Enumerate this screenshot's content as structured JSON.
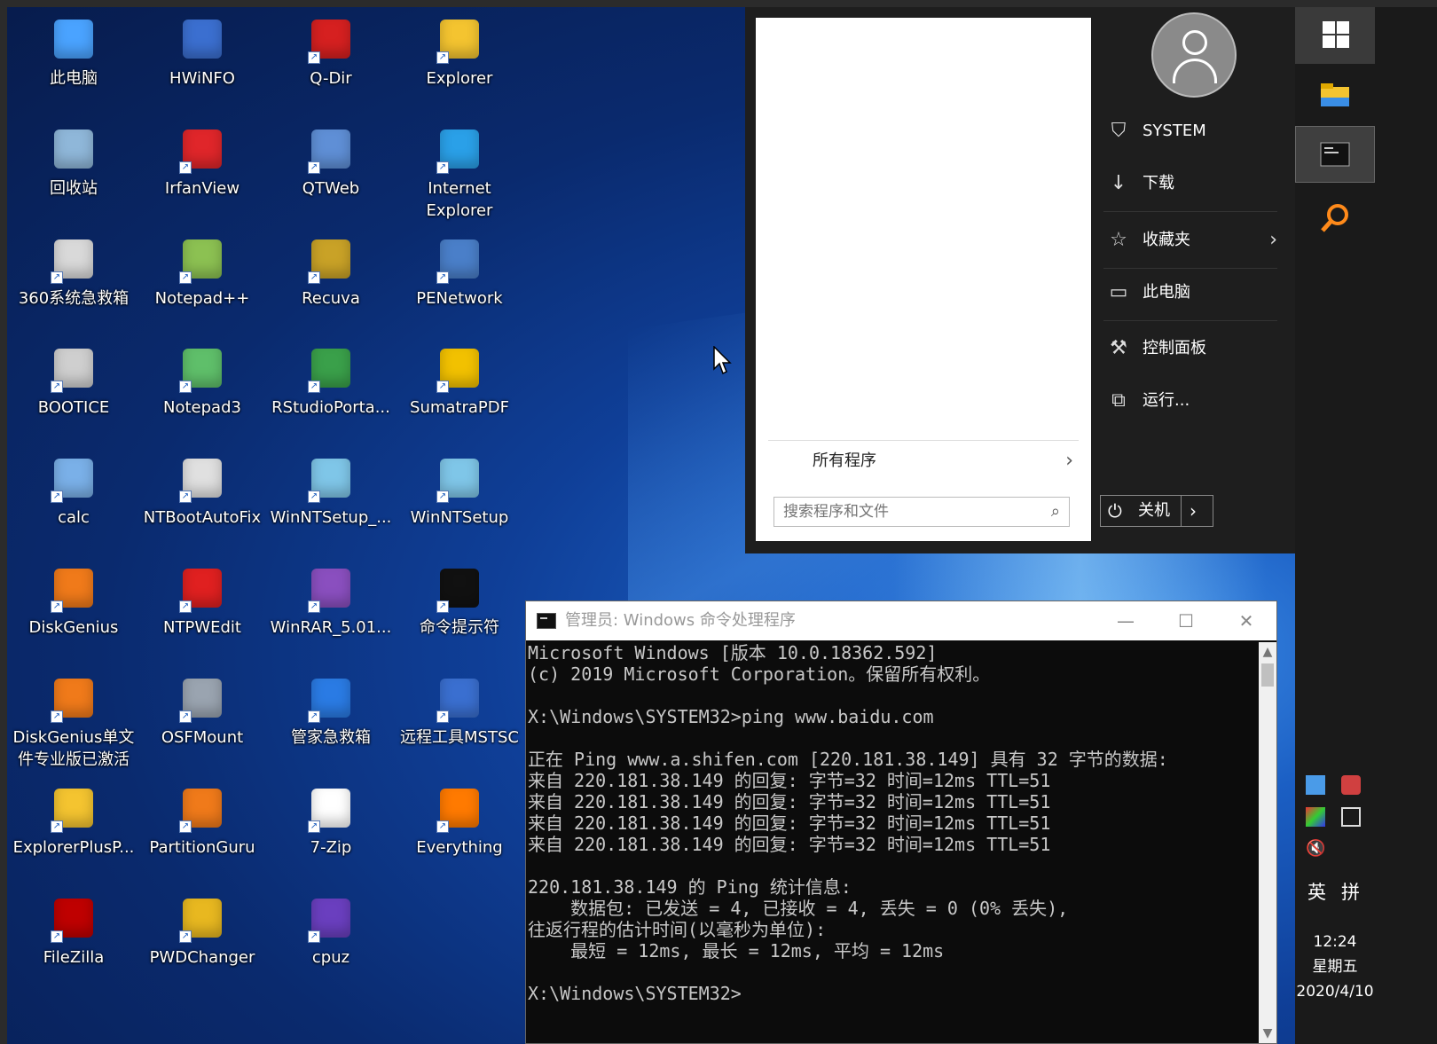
{
  "desktop": {
    "icons": [
      {
        "label": "此电脑",
        "icon": "computer-icon",
        "color": "#4aa3ff"
      },
      {
        "label": "HWiNFO",
        "icon": "hwinfo-icon",
        "color": "#3b6fd0"
      },
      {
        "label": "Q-Dir",
        "icon": "qdir-icon",
        "color": "#d62020"
      },
      {
        "label": "Explorer",
        "icon": "folder-icon",
        "color": "#f4c430"
      },
      {
        "label": "回收站",
        "icon": "recycle-bin-icon",
        "color": "#8fb7d9"
      },
      {
        "label": "IrfanView",
        "icon": "irfanview-icon",
        "color": "#e0262a"
      },
      {
        "label": "QTWeb",
        "icon": "qtweb-icon",
        "color": "#5f8fd6"
      },
      {
        "label": "Internet Explorer",
        "icon": "ie-icon",
        "color": "#2aa0e8"
      },
      {
        "label": "360系统急救箱",
        "icon": "first-aid-kit-icon",
        "color": "#d9d9d9"
      },
      {
        "label": "Notepad++",
        "icon": "notepad-plus-plus-icon",
        "color": "#8cc152"
      },
      {
        "label": "Recuva",
        "icon": "recuva-icon",
        "color": "#c9a227"
      },
      {
        "label": "PENetwork",
        "icon": "network-icon",
        "color": "#4a7fc9"
      },
      {
        "label": "BOOTICE",
        "icon": "bootice-icon",
        "color": "#cfcfcf"
      },
      {
        "label": "Notepad3",
        "icon": "notepad3-icon",
        "color": "#5fbf6a"
      },
      {
        "label": "RStudioPorta...",
        "icon": "rstudio-icon",
        "color": "#3aa04a"
      },
      {
        "label": "SumatraPDF",
        "icon": "pdf-icon",
        "color": "#f2c100"
      },
      {
        "label": "calc",
        "icon": "calculator-icon",
        "color": "#7ab0e8"
      },
      {
        "label": "NTBootAutoFix",
        "icon": "ntboot-icon",
        "color": "#e0e0e0"
      },
      {
        "label": "WinNTSetup_...",
        "icon": "winntsetup-icon",
        "color": "#7fc6e8"
      },
      {
        "label": "WinNTSetup",
        "icon": "winntsetup-icon",
        "color": "#7fc6e8"
      },
      {
        "label": "DiskGenius",
        "icon": "diskgenius-icon",
        "color": "#f07a1a"
      },
      {
        "label": "NTPWEdit",
        "icon": "ntpwedit-icon",
        "color": "#e02020"
      },
      {
        "label": "WinRAR_5.01...",
        "icon": "winrar-icon",
        "color": "#8a4fbf"
      },
      {
        "label": "命令提示符",
        "icon": "cmd-icon",
        "color": "#111111"
      },
      {
        "label": "DiskGenius单文件专业版已激活",
        "icon": "diskgenius-icon",
        "color": "#f07a1a"
      },
      {
        "label": "OSFMount",
        "icon": "osfmount-icon",
        "color": "#9aa4b0"
      },
      {
        "label": "管家急救箱",
        "icon": "shield-icon",
        "color": "#2a7be4"
      },
      {
        "label": "远程工具MSTSC",
        "icon": "remote-desktop-icon",
        "color": "#3a6fd0"
      },
      {
        "label": "ExplorerPlusP...",
        "icon": "folder-icon",
        "color": "#f4c430"
      },
      {
        "label": "PartitionGuru",
        "icon": "partitionguru-icon",
        "color": "#f07a1a"
      },
      {
        "label": "7-Zip",
        "icon": "sevenzip-icon",
        "color": "#ffffff"
      },
      {
        "label": "Everything",
        "icon": "everything-icon",
        "color": "#ff7a00"
      },
      {
        "label": "FileZilla",
        "icon": "filezilla-icon",
        "color": "#bf0000"
      },
      {
        "label": "PWDChanger",
        "icon": "key-icon",
        "color": "#e8b820"
      },
      {
        "label": "cpuz",
        "icon": "cpuz-icon",
        "color": "#6a3fbf"
      }
    ]
  },
  "start_menu": {
    "all_programs": "所有程序",
    "search_placeholder": "搜索程序和文件",
    "items": [
      {
        "label": "SYSTEM",
        "icon": "user-icon"
      },
      {
        "label": "下载",
        "icon": "download-icon"
      },
      {
        "label": "收藏夹",
        "icon": "star-icon"
      },
      {
        "label": "此电脑",
        "icon": "computer-icon"
      },
      {
        "label": "控制面板",
        "icon": "wrench-icon"
      },
      {
        "label": "运行...",
        "icon": "run-icon"
      }
    ],
    "shutdown_label": "关机"
  },
  "taskbar": {
    "clock_time": "12:24",
    "clock_day": "星期五",
    "clock_date": "2020/4/10",
    "ime_lang": "英",
    "ime_mode": "拼"
  },
  "cmd": {
    "title": "管理员: Windows 命令处理程序",
    "lines": [
      "Microsoft Windows [版本 10.0.18362.592]",
      "(c) 2019 Microsoft Corporation。保留所有权利。",
      "",
      "X:\\Windows\\SYSTEM32>ping www.baidu.com",
      "",
      "正在 Ping www.a.shifen.com [220.181.38.149] 具有 32 字节的数据:",
      "来自 220.181.38.149 的回复: 字节=32 时间=12ms TTL=51",
      "来自 220.181.38.149 的回复: 字节=32 时间=12ms TTL=51",
      "来自 220.181.38.149 的回复: 字节=32 时间=12ms TTL=51",
      "来自 220.181.38.149 的回复: 字节=32 时间=12ms TTL=51",
      "",
      "220.181.38.149 的 Ping 统计信息:",
      "    数据包: 已发送 = 4, 已接收 = 4, 丢失 = 0 (0% 丢失),",
      "往返行程的估计时间(以毫秒为单位):",
      "    最短 = 12ms, 最长 = 12ms, 平均 = 12ms",
      "",
      "X:\\Windows\\SYSTEM32>"
    ]
  }
}
